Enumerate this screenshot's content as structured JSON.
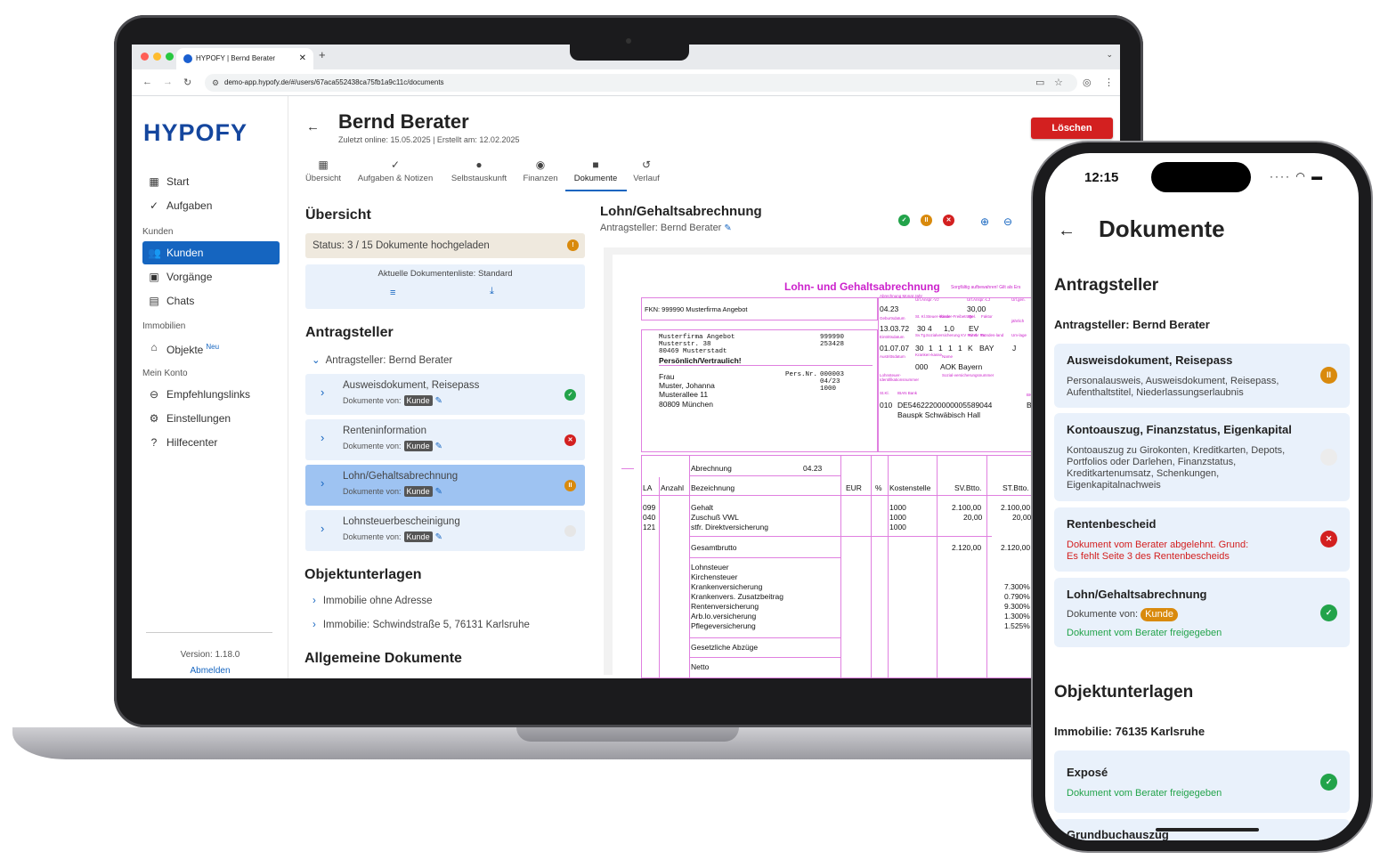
{
  "browser": {
    "tab_title": "HYPOFY | Bernd Berater",
    "url": "demo-app.hypofy.de/#/users/67aca552438ca75fb1a9c11c/documents"
  },
  "sidebar": {
    "logo": "HYPOFY",
    "items": [
      {
        "label": "Start"
      },
      {
        "label": "Aufgaben"
      },
      {
        "section": "Kunden"
      },
      {
        "label": "Kunden"
      },
      {
        "label": "Vorgänge"
      },
      {
        "label": "Chats"
      },
      {
        "section": "Immobilien"
      },
      {
        "label": "Objekte",
        "badge": "Neu"
      },
      {
        "section": "Mein Konto"
      },
      {
        "label": "Empfehlungslinks"
      },
      {
        "label": "Einstellungen"
      },
      {
        "label": "Hilfecenter"
      }
    ],
    "version": "Version: 1.18.0",
    "logout": "Abmelden"
  },
  "header": {
    "name": "Bernd Berater",
    "sub": "Zuletzt online: 15.05.2025 | Erstellt am: 12.02.2025",
    "delete": "Löschen"
  },
  "tabs": [
    "Übersicht",
    "Aufgaben & Notizen",
    "Selbstauskunft",
    "Finanzen",
    "Dokumente",
    "Verlauf"
  ],
  "overview": {
    "title": "Übersicht",
    "status": "Status: 3 / 15 Dokumente hochgeladen",
    "doclist": "Aktuelle Dokumentenliste: Standard"
  },
  "applicant": {
    "title": "Antragsteller",
    "label": "Antragsteller: Bernd Berater",
    "uploaded_by": "Dokumente von:",
    "kunde": "Kunde",
    "docs": [
      {
        "title": "Ausweisdokument, Reisepass",
        "status": "ok"
      },
      {
        "title": "Renteninformation",
        "status": "rejected"
      },
      {
        "title": "Lohn/Gehaltsabrechnung",
        "status": "pending"
      },
      {
        "title": "Lohnsteuerbescheinigung",
        "status": "none"
      }
    ]
  },
  "objects": {
    "title": "Objektunterlagen",
    "items": [
      "Immobilie ohne Adresse",
      "Immobilie: Schwindstraße 5, 76131 Karlsruhe"
    ]
  },
  "general": {
    "title": "Allgemeine Dokumente"
  },
  "preview": {
    "title": "Lohn/Gehaltsabrechnung",
    "sub": "Antragsteller: Bernd Berater",
    "doc": {
      "heading": "Lohn- und Gehaltsabrechnung",
      "heading_note": "Sorgfältig aufbewahren! Gilt als Ers",
      "fkn": "FKN: 999990 Musterfirma Angebot",
      "company": [
        "Musterfirma Angebot",
        "Musterstr. 38",
        "80469  Musterstadt"
      ],
      "company_nr": [
        "999990",
        "253428"
      ],
      "confidential": "Persönlich/Vertraulich!",
      "recipient": [
        "Frau",
        "Muster, Johanna",
        "Musterallee 11",
        "80809 München"
      ],
      "persnr_label": "Pers.Nr.",
      "persnr": [
        "000003",
        "04/23",
        "1000"
      ],
      "right_labels": [
        "Abrechnung Monat Jahr",
        "Url.Anspr.-VJ",
        "Url.Anspr.-LJ",
        "Url.gen.",
        "Geburtsdatum",
        "St. Kl.",
        "Steuer-klasse",
        "Kinder-Freibeträge",
        "Rel.",
        "Faktor",
        "jährlich",
        "Eintrittsdatum",
        "Sv.Tg.",
        "Sozialversicherung KV RV AV PV",
        "Kind.",
        "Bundes-land",
        "Um-lage",
        "Austrittsdatum",
        "Kranken-kasse",
        "Name",
        "Lohnsteuer-Identifikationsnummer",
        "Sozial-versicherungsnummer",
        "St.Kl.",
        "IBAN Bank",
        "BIC"
      ],
      "right_values": [
        "04.23",
        "30,00",
        "13.03.72",
        "30",
        "4",
        "1,0",
        "EV",
        "01.07.07",
        "30",
        "1",
        "1",
        "1",
        "1",
        "K",
        "BAY",
        "J",
        "000",
        "AOK Bayern",
        "010",
        "DE54622200000005589044",
        "Bauspk Schwäbisch Hall",
        "BSH"
      ],
      "abrechnung": "Abrechnung",
      "abrechnung_date": "04.23",
      "cols": [
        "LA",
        "Anzahl",
        "Bezeichnung",
        "EUR",
        "%",
        "Kostenstelle",
        "SV.Btto.",
        "ST.Btto."
      ],
      "la": [
        "099",
        "040",
        "121"
      ],
      "bez": [
        "Gehalt",
        "Zuschuß VWL",
        "stfr. Direktversicherung"
      ],
      "kst": [
        "1000",
        "1000",
        "1000"
      ],
      "sv": [
        "2.100,00",
        "20,00"
      ],
      "st": [
        "2.100,00",
        "20,00"
      ],
      "gesamt": "Gesamtbrutto",
      "gesamt_sv": "2.120,00",
      "gesamt_st": "2.120,00",
      "deductions": [
        "Lohnsteuer",
        "Kirchensteuer",
        "Krankenversicherung",
        "Krankenvers. Zusatzbeitrag",
        "Rentenversicherung",
        "Arb.lo.versicherung",
        "Pflegeversicherung"
      ],
      "rates": [
        "7.300%",
        "0.790%",
        "9.300%",
        "1.300%",
        "1.525%"
      ],
      "abzuege": "Gesetzliche Abzüge",
      "netto": "Netto"
    }
  },
  "phone": {
    "time": "12:15",
    "title": "Dokumente",
    "section1": "Antragsteller",
    "applicant": "Antragsteller: Bernd Berater",
    "cards": [
      {
        "title": "Ausweisdokument, Reisepass",
        "desc": "Personalausweis, Ausweisdokument, Reisepass, Aufenthaltstitel, Niederlassungserlaubnis"
      },
      {
        "title": "Kontoauszug, Finanzstatus, Eigenkapital",
        "desc": "Kontoauszug zu Girokonten, Kreditkarten, Depots, Portfolios oder Darlehen, Finanzstatus, Kreditkartenumsatz, Schenkungen, Eigenkapitalnachweis"
      },
      {
        "title": "Rentenbescheid",
        "rejected1": "Dokument vom Berater abgelehnt. Grund:",
        "rejected2": "Es fehlt Seite 3 des Rentenbescheids"
      },
      {
        "title": "Lohn/Gehaltsabrechnung",
        "by": "Dokumente von:",
        "kunde": "Kunde",
        "approved": "Dokument vom Berater freigegeben"
      }
    ],
    "section2": "Objektunterlagen",
    "property": "Immobilie: 76135 Karlsruhe",
    "expose": {
      "title": "Exposé",
      "approved": "Dokument vom Berater freigegeben"
    },
    "next": "Grundbuchauszug"
  },
  "colors": {
    "primary": "#1565c0",
    "danger": "#d32020",
    "ok": "#22a34a",
    "warn": "#d98a0d",
    "doc_magenta": "#cc22cc"
  }
}
